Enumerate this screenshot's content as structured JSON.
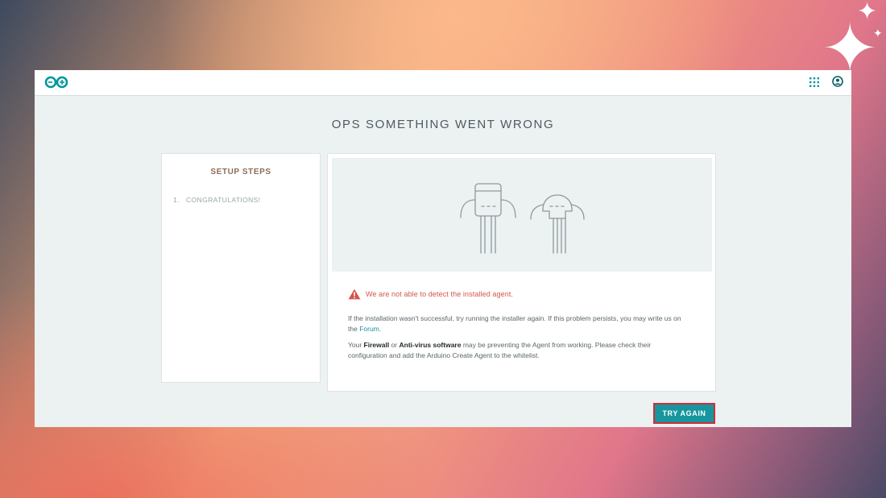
{
  "decor": {
    "sparkle_big": "✦",
    "sparkle_small": "✦",
    "sparkle_tiny": "✦"
  },
  "topbar": {
    "logo_icon": "arduino-infinity-logo",
    "apps_icon": "grid-apps-icon",
    "account_icon": "user-account-icon",
    "accent_color": "#00979d"
  },
  "page": {
    "title": "OPS SOMETHING WENT WRONG"
  },
  "setup_steps": {
    "title": "SETUP STEPS",
    "items": [
      {
        "number": "1.",
        "label": "CONGRATULATIONS!"
      }
    ]
  },
  "error_panel": {
    "illustration": "two-robot-characters",
    "warning_icon": "warning-triangle-icon",
    "warning_color": "#d2564a",
    "error_message": "We are not able to detect the installed agent.",
    "para1": {
      "text_before": "If the installation wasn't successful, try running the installer again. If this problem persists, you may write us on the ",
      "link_text": "Forum",
      "text_after": "."
    },
    "para2": {
      "text_before": "Your ",
      "bold1": "Firewall",
      "text_middle": " or ",
      "bold2": "Anti-virus software",
      "text_after": " may be preventing the Agent from working. Please check their configuration and add the Arduino Create Agent to the whitelist."
    }
  },
  "actions": {
    "try_again_label": "TRY AGAIN",
    "button_color": "#17969e",
    "highlight_color": "#d42c3a"
  }
}
